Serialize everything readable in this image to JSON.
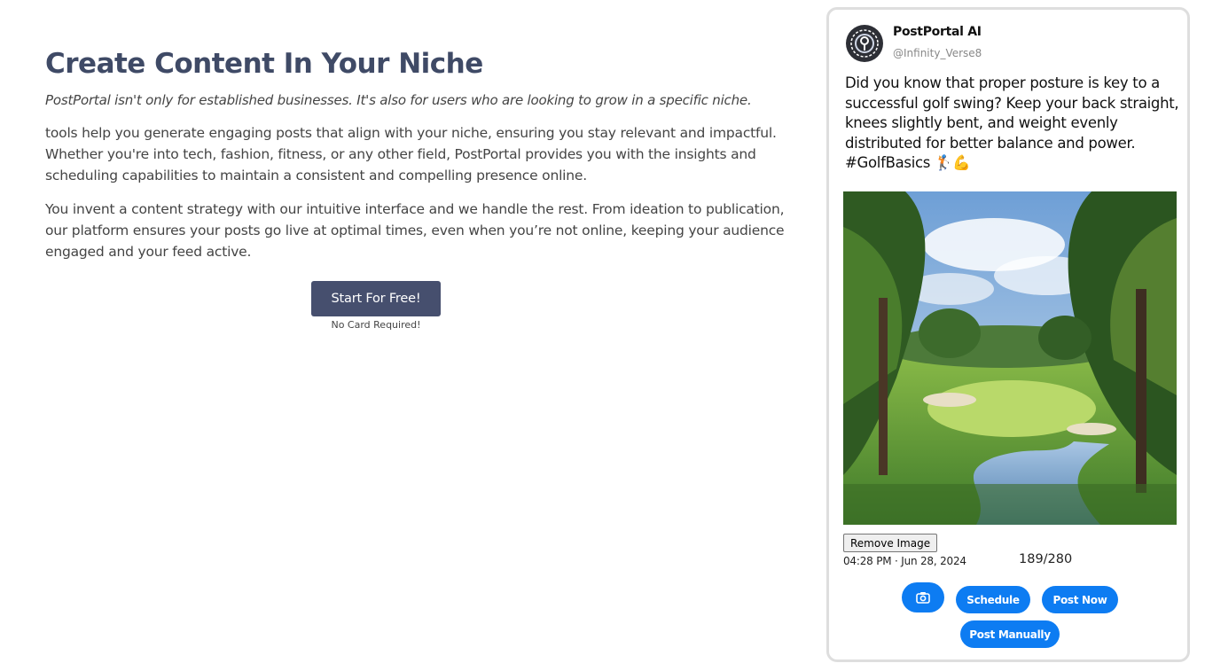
{
  "main": {
    "title": "Create Content In Your Niche",
    "subtitle": "PostPortal isn't only for established businesses. It's also for users who are looking to grow in a specific niche.",
    "paragraphs": [
      "tools help you generate engaging posts that align with your niche, ensuring you stay relevant and impactful. Whether you're into tech, fashion, fitness, or any other field, PostPortal provides you with the insights and scheduling capabilities to maintain a consistent and compelling presence online.",
      "You invent a content strategy with our intuitive interface and we handle the rest. From ideation to publication, our platform ensures your posts go live at optimal times, even when you’re not online, keeping your audience engaged and your feed active."
    ],
    "cta_label": "Start For Free!",
    "cta_note": "No Card Required!"
  },
  "post_card": {
    "account_name": "PostPortal AI",
    "account_handle": "@Infinity_Verse8",
    "text": "Did you know that proper posture is key to a successful golf swing? Keep your back straight, knees slightly bent, and weight evenly distributed for better balance and power. #GolfBasics 🏌️💪",
    "image_icon": "golf-course-painting",
    "remove_image_label": "Remove Image",
    "timestamp": "04:28 PM · Jun 28, 2024",
    "char_count": "189/280",
    "buttons": {
      "camera_icon": "camera-icon",
      "schedule": "Schedule",
      "post_now": "Post Now",
      "post_manually": "Post Manually"
    }
  },
  "colors": {
    "heading": "#3f4a66",
    "cta_bg": "#464f6e",
    "action_blue": "#0d7cf2"
  }
}
